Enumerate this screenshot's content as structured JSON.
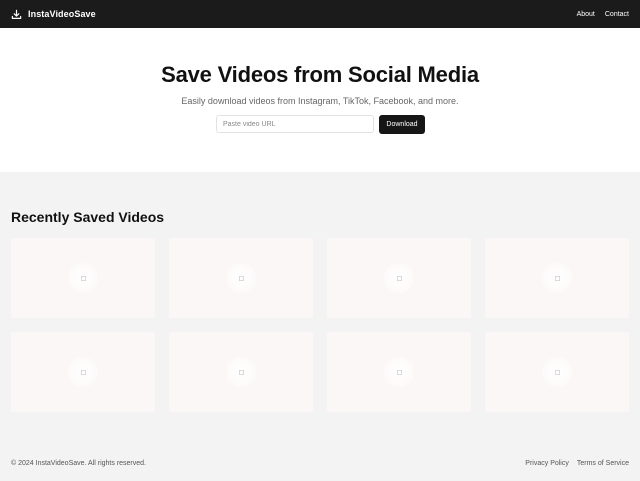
{
  "brand": {
    "name": "InstaVideoSave",
    "icon": "download-icon"
  },
  "nav": {
    "about": "About",
    "contact": "Contact"
  },
  "hero": {
    "title": "Save Videos from Social Media",
    "subtitle": "Easily download videos from Instagram, TikTok, Facebook, and more.",
    "input_placeholder": "Paste video URL",
    "input_value": "",
    "button_label": "Download"
  },
  "recent": {
    "title": "Recently Saved Videos",
    "cards": [
      {
        "icon": "video-thumbnail-icon"
      },
      {
        "icon": "video-thumbnail-icon"
      },
      {
        "icon": "video-thumbnail-icon"
      },
      {
        "icon": "video-thumbnail-icon"
      },
      {
        "icon": "video-thumbnail-icon"
      },
      {
        "icon": "video-thumbnail-icon"
      },
      {
        "icon": "video-thumbnail-icon"
      },
      {
        "icon": "video-thumbnail-icon"
      }
    ]
  },
  "footer": {
    "copyright": "© 2024 InstaVideoSave. All rights reserved.",
    "privacy": "Privacy Policy",
    "terms": "Terms of Service"
  },
  "colors": {
    "nav_bg": "#1b1b1b",
    "page_bg": "#f4f3f3",
    "hero_bg": "#ffffff",
    "card_bg": "#fbf7f7",
    "button_bg": "#161616"
  }
}
